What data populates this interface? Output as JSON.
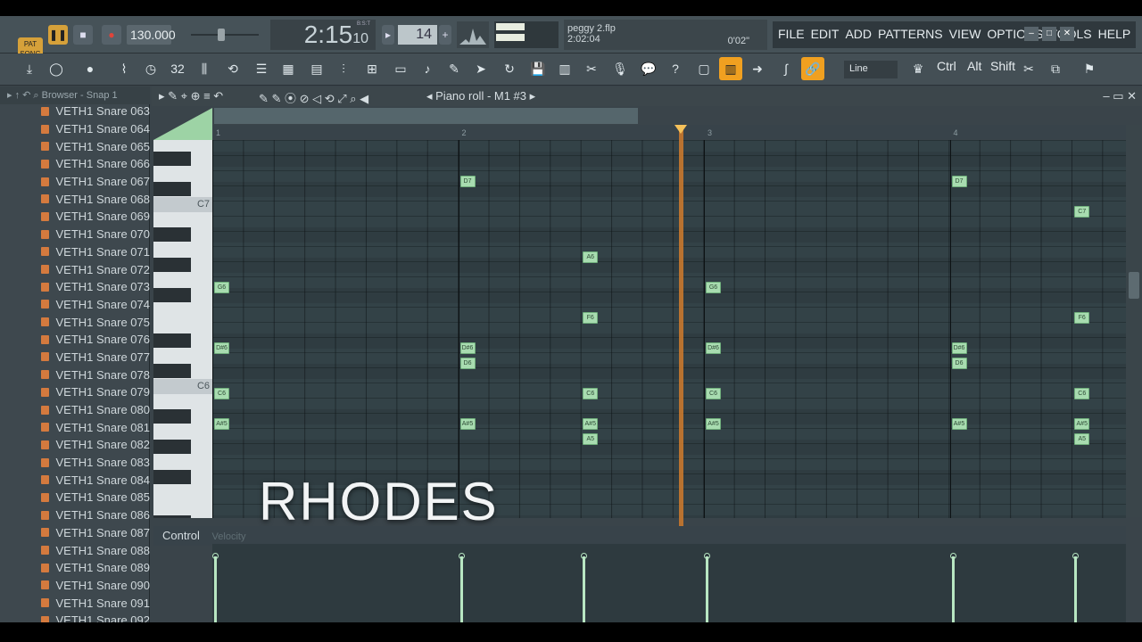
{
  "transport": {
    "pat_label": "PAT",
    "song_label": "SONG",
    "tempo": "130.000",
    "time_main": "2:15",
    "time_sub": "10",
    "time_label": "B:S:T",
    "pattern_number": "14"
  },
  "file": {
    "name": "peggy 2.flp",
    "duration": "2:02:04",
    "cpu": "0'02\""
  },
  "menu": [
    "FILE",
    "EDIT",
    "ADD",
    "PATTERNS",
    "VIEW",
    "OPTIONS",
    "TOOLS",
    "HELP"
  ],
  "toolbar": {
    "line_mode": "Line",
    "ctrl": "Ctrl",
    "alt": "Alt",
    "shift": "Shift"
  },
  "browser": {
    "title": "Browser - Snap 1",
    "items": [
      "VETH1 Snare 063",
      "VETH1 Snare 064",
      "VETH1 Snare 065",
      "VETH1 Snare 066",
      "VETH1 Snare 067",
      "VETH1 Snare 068",
      "VETH1 Snare 069",
      "VETH1 Snare 070",
      "VETH1 Snare 071",
      "VETH1 Snare 072",
      "VETH1 Snare 073",
      "VETH1 Snare 074",
      "VETH1 Snare 075",
      "VETH1 Snare 076",
      "VETH1 Snare 077",
      "VETH1 Snare 078",
      "VETH1 Snare 079",
      "VETH1 Snare 080",
      "VETH1 Snare 081",
      "VETH1 Snare 082",
      "VETH1 Snare 083",
      "VETH1 Snare 084",
      "VETH1 Snare 085",
      "VETH1 Snare 086",
      "VETH1 Snare 087",
      "VETH1 Snare 088",
      "VETH1 Snare 089",
      "VETH1 Snare 090",
      "VETH1 Snare 091",
      "VETH1 Snare 092"
    ]
  },
  "piano_roll": {
    "title": "Piano roll - M1 #3",
    "ruler": [
      "1",
      "2",
      "3",
      "4"
    ],
    "key_labels": {
      "c7": "C7",
      "c6": "C6"
    },
    "notes": [
      {
        "name": "D7",
        "bar": 2.0
      },
      {
        "name": "D7",
        "bar": 4.0
      },
      {
        "name": "C7",
        "bar": 4.5
      },
      {
        "name": "A6",
        "bar": 2.5
      },
      {
        "name": "G6",
        "bar": 1.0
      },
      {
        "name": "G6",
        "bar": 3.0
      },
      {
        "name": "F6",
        "bar": 2.5
      },
      {
        "name": "F6",
        "bar": 4.5
      },
      {
        "name": "D#6",
        "bar": 1.0
      },
      {
        "name": "D#6",
        "bar": 2.0
      },
      {
        "name": "D#6",
        "bar": 3.0
      },
      {
        "name": "D#6",
        "bar": 4.0
      },
      {
        "name": "D6",
        "bar": 2.0
      },
      {
        "name": "D6",
        "bar": 4.0
      },
      {
        "name": "C6",
        "bar": 1.0
      },
      {
        "name": "C6",
        "bar": 2.5
      },
      {
        "name": "C6",
        "bar": 3.0
      },
      {
        "name": "C6",
        "bar": 4.5
      },
      {
        "name": "A#5",
        "bar": 1.0
      },
      {
        "name": "A#5",
        "bar": 2.0
      },
      {
        "name": "A#5",
        "bar": 2.5
      },
      {
        "name": "A#5",
        "bar": 3.0
      },
      {
        "name": "A#5",
        "bar": 4.0
      },
      {
        "name": "A#5",
        "bar": 4.5
      },
      {
        "name": "A5",
        "bar": 2.5
      },
      {
        "name": "A5",
        "bar": 4.5
      }
    ],
    "playhead_bar": 2.9
  },
  "overlay_text": "RHODES",
  "control": {
    "label": "Control",
    "param": "Velocity",
    "velocities": [
      {
        "bar": 1.0,
        "value": 0.88
      },
      {
        "bar": 2.0,
        "value": 0.88
      },
      {
        "bar": 2.5,
        "value": 0.88
      },
      {
        "bar": 3.0,
        "value": 0.88
      },
      {
        "bar": 4.0,
        "value": 0.88
      },
      {
        "bar": 4.5,
        "value": 0.88
      }
    ]
  },
  "colors": {
    "note": "#a8dcb0",
    "playhead": "#c8782e",
    "accent": "#f0a020"
  }
}
